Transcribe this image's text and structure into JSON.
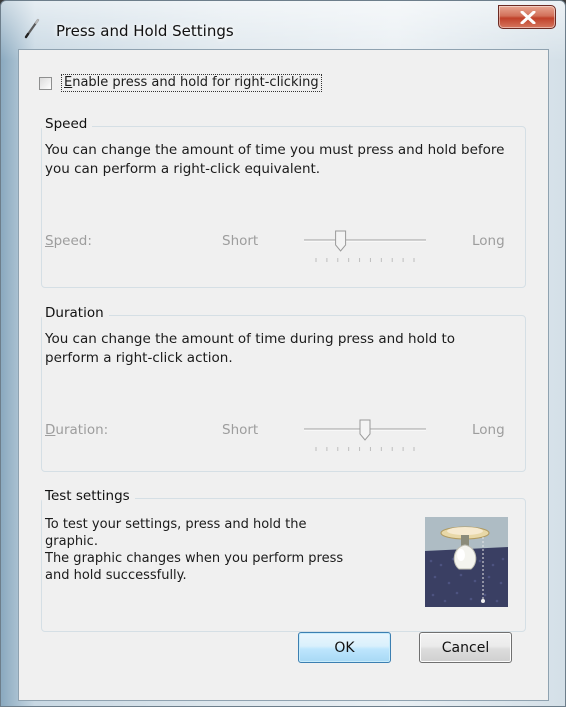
{
  "window": {
    "title": "Press and Hold Settings"
  },
  "enable_checkbox": {
    "label": "Enable press and hold for right-clicking",
    "checked": false
  },
  "speed_group": {
    "title": "Speed",
    "description": "You can change the amount of time you must press and hold before you can perform a right-click equivalent.",
    "slider_label_underlined": "S",
    "slider_label_rest": "peed:",
    "min_label": "Short",
    "max_label": "Long",
    "value_fraction": 0.3,
    "tick_count": 10,
    "enabled": false
  },
  "duration_group": {
    "title": "Duration",
    "description": "You can change the amount of time during press and hold to perform a right-click action.",
    "slider_label_underlined": "D",
    "slider_label_rest": "uration:",
    "min_label": "Short",
    "max_label": "Long",
    "value_fraction": 0.5,
    "tick_count": 10,
    "enabled": false
  },
  "test_group": {
    "title": "Test settings",
    "line1": "To test your settings, press and hold the graphic.",
    "line2": "The graphic changes when you perform press",
    "line3": "and hold successfully."
  },
  "buttons": {
    "ok": "OK",
    "cancel": "Cancel"
  },
  "icons": {
    "title_icon": "pen-icon",
    "close_icon": "close-icon",
    "test_graphic": "light-bulb-graphic"
  },
  "colors": {
    "close_button": "#c8452d",
    "disabled_text": "#9d9d9d",
    "ok_button_border": "#3c7fb1"
  }
}
